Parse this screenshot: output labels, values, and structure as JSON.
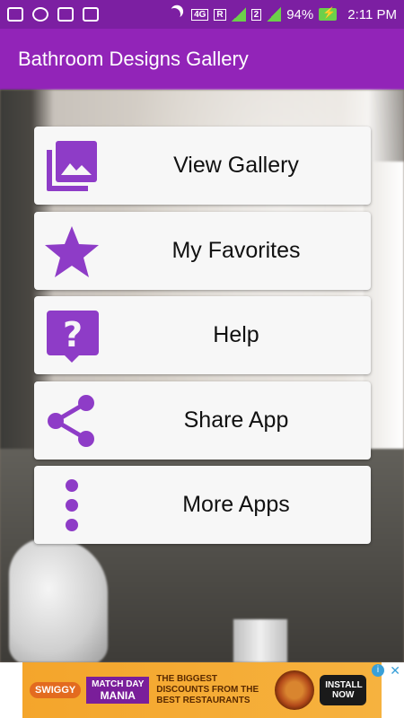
{
  "status_bar": {
    "signal_label_4g": "4G",
    "roaming_label": "R",
    "sim2_label": "2",
    "battery": "94%",
    "time": "2:11 PM"
  },
  "app_bar": {
    "title": "Bathroom Designs Gallery"
  },
  "menu": {
    "items": [
      {
        "label": "View Gallery",
        "icon": "photo-library-icon"
      },
      {
        "label": "My Favorites",
        "icon": "star-icon"
      },
      {
        "label": "Help",
        "icon": "help-bubble-icon"
      },
      {
        "label": "Share App",
        "icon": "share-icon"
      },
      {
        "label": "More Apps",
        "icon": "more-vert-icon"
      }
    ],
    "accent_color": "#8e3cc7"
  },
  "ad": {
    "swiggy": "SWIGGY",
    "match_day": "MATCH DAY",
    "mania": "MANIA",
    "text_line1": "THE BIGGEST",
    "text_line2": "DISCOUNTS FROM THE",
    "text_line3": "BEST RESTAURANTS",
    "install_line1": "INSTALL",
    "install_line2": "NOW",
    "info": "i",
    "close": "✕"
  },
  "colors": {
    "status_bar": "#7c1fa2",
    "app_bar": "#9224b8",
    "icon_purple": "#8e3cc7"
  }
}
